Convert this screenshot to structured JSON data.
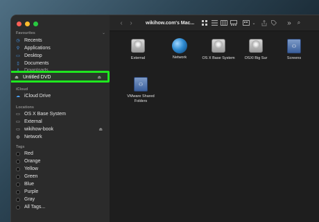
{
  "window": {
    "title": "wikihow.com's Mac..."
  },
  "sidebar": {
    "favourites_header": "Favourites",
    "favourites": [
      {
        "label": "Recents",
        "icon": "clock-icon"
      },
      {
        "label": "Applications",
        "icon": "applications-icon"
      },
      {
        "label": "Desktop",
        "icon": "desktop-icon"
      },
      {
        "label": "Documents",
        "icon": "document-icon"
      },
      {
        "label": "Downloads",
        "icon": "download-icon"
      }
    ],
    "selected_item": {
      "label": "Untitled DVD",
      "icon": "dvd-icon",
      "eject": "⏏"
    },
    "icloud_header": "iCloud",
    "icloud": [
      {
        "label": "iCloud Drive",
        "icon": "cloud-icon"
      }
    ],
    "locations_header": "Locations",
    "locations": [
      {
        "label": "OS X Base System",
        "icon": "disk-icon",
        "eject": ""
      },
      {
        "label": "External",
        "icon": "disk-icon",
        "eject": ""
      },
      {
        "label": "wikihow-book",
        "icon": "disk-icon",
        "eject": "⏏"
      },
      {
        "label": "Network",
        "icon": "network-icon",
        "eject": ""
      }
    ],
    "tags_header": "Tags",
    "tags": [
      {
        "label": "Red"
      },
      {
        "label": "Orange"
      },
      {
        "label": "Yellow"
      },
      {
        "label": "Green"
      },
      {
        "label": "Blue"
      },
      {
        "label": "Purple"
      },
      {
        "label": "Gray"
      },
      {
        "label": "All Tags..."
      }
    ]
  },
  "toolbar": {
    "back": "‹",
    "forward": "›",
    "more": "»",
    "search": "⌕"
  },
  "files": [
    {
      "label": "External",
      "icon": "hard-disk-icon"
    },
    {
      "label": "Network",
      "icon": "network-globe-icon"
    },
    {
      "label": "OS X Base System",
      "icon": "hard-disk-icon"
    },
    {
      "label": "OSXI Big Sur",
      "icon": "hard-disk-icon"
    },
    {
      "label": "Screens",
      "icon": "shared-server-icon"
    },
    {
      "label": "VMware Shared Folders",
      "icon": "shared-server-icon"
    }
  ]
}
